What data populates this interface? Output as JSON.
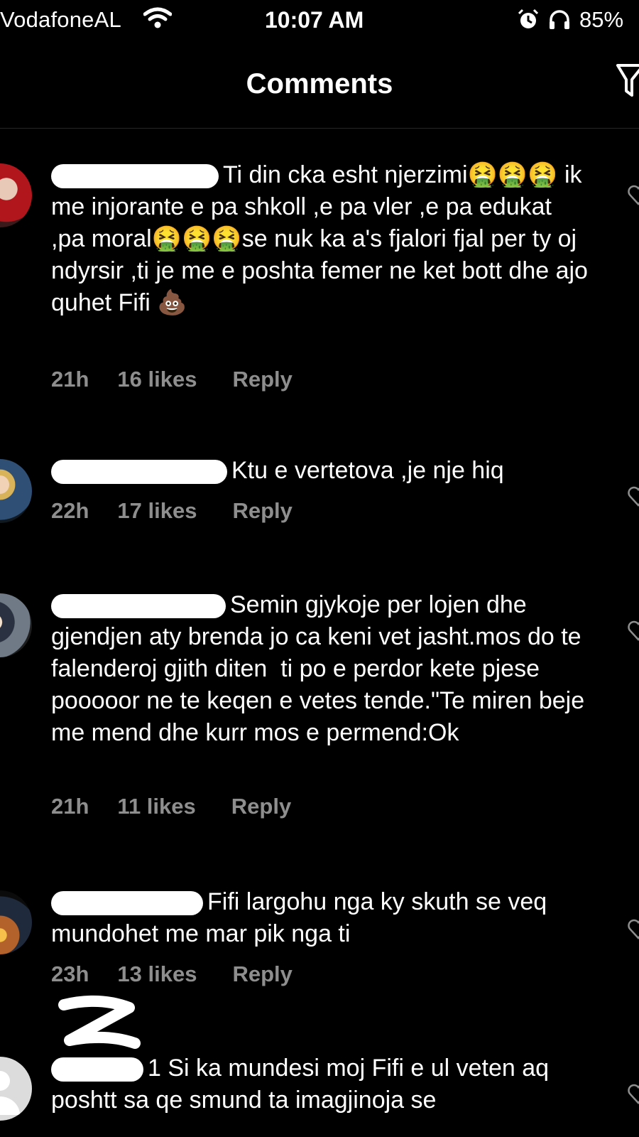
{
  "status_bar": {
    "carrier": "VodafoneAL",
    "time": "10:07 AM",
    "battery": "85%"
  },
  "header": {
    "title": "Comments"
  },
  "comments": [
    {
      "username": "",
      "text": "Ti din cka esht njerzimi🤮🤮🤮 ik me injorante e pa shkoll ,e pa vler ,e pa edukat ,pa moral🤮🤮🤮se nuk ka a's fjalori fjal per ty oj ndyrsir ,ti je me e poshta femer ne ket bott dhe ajo quhet Fifi 💩",
      "time": "21h",
      "likes": "16 likes",
      "reply": "Reply"
    },
    {
      "username": "",
      "text": "Ktu e vertetova ,je nje hiq",
      "time": "22h",
      "likes": "17 likes",
      "reply": "Reply"
    },
    {
      "username": "",
      "text": "Semin gjykoje per lojen dhe gjendjen aty brenda jo ca keni vet jasht.mos do te falenderoj gjith diten  ti po e perdor kete pjese pooooor ne te keqen e vetes tende.\"Te miren beje me mend dhe kurr mos e permend:Ok",
      "time": "21h",
      "likes": "11 likes",
      "reply": "Reply"
    },
    {
      "username": "",
      "text": "Fifi largohu nga ky skuth se veq mundohet me mar pik nga ti",
      "time": "23h",
      "likes": "13 likes",
      "reply": "Reply"
    },
    {
      "username": "",
      "text": "1 Si ka mundesi moj Fifi e ul veten aq poshtt sa qe smund ta imagjinoja se",
      "time": "",
      "likes": "",
      "reply": ""
    }
  ],
  "colors": {
    "background": "#000000",
    "text": "#ffffff",
    "meta": "#8e8e8e"
  },
  "icons": [
    "wifi-icon",
    "alarm-icon",
    "headphones-icon",
    "filter-icon",
    "heart-icon"
  ]
}
